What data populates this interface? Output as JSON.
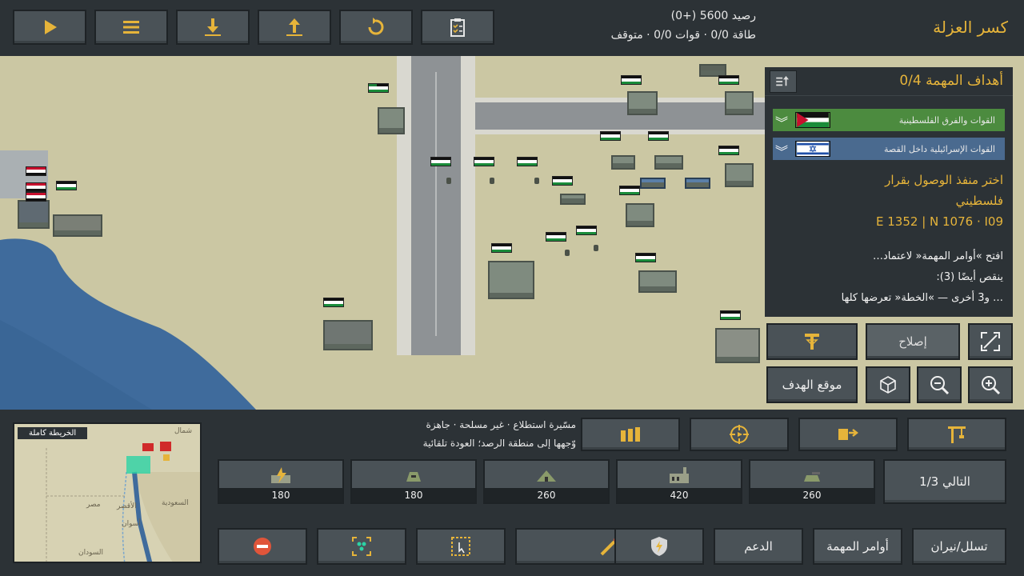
{
  "top": {
    "mission_title": "كسر العزلة",
    "resources_line": "رصيد 5600 (+0)",
    "status_line": "طاقة 0/0 · قوات 0/0 · متوقف"
  },
  "objectives": {
    "title": "أهداف المهمة  0/4",
    "teams": [
      {
        "name": "القوات والفرق الفلسطينية",
        "color": "#4c8b3f"
      },
      {
        "name": "القوات الإسرائيلية داخل القصة",
        "color": "#4a6a8f"
      }
    ],
    "desc_lines": [
      "اختر منفذ الوصول بقرار",
      "فلسطيني",
      "E 1352 | N 1076 · I09"
    ],
    "notes": [
      "افتح »أوامر المهمة« لاعتماد…",
      "ينقص أيضًا (3):",
      "… و3 أخرى — »الخطة« تعرضها كلها"
    ]
  },
  "panel_buttons": {
    "repair": "إصلاح",
    "target_location": "موقع الهدف"
  },
  "minimap": {
    "label": "الخريطة كاملة",
    "places": [
      "شمال",
      "مصر",
      "السعودية",
      "السودان",
      "الأقصر",
      "أسوان"
    ]
  },
  "unit_info": {
    "line1": "مسّيرة استطلاع · غير مسلحة · جاهزة",
    "line2": "وّجهها إلى منطقة الرصد؛ العودة تلقائية"
  },
  "build": {
    "next_label": "التالي 1/3",
    "costs": [
      "180",
      "180",
      "260",
      "420",
      "260"
    ]
  },
  "tabs": {
    "support": "الدعم",
    "orders": "أوامر المهمة",
    "infiltrate": "تسلل/نيران"
  },
  "colors": {
    "accent": "#e6b43a",
    "panel": "#2c3236",
    "button": "#4a5257",
    "map": "#cbc7a3",
    "sea": "#3f6b9c"
  }
}
